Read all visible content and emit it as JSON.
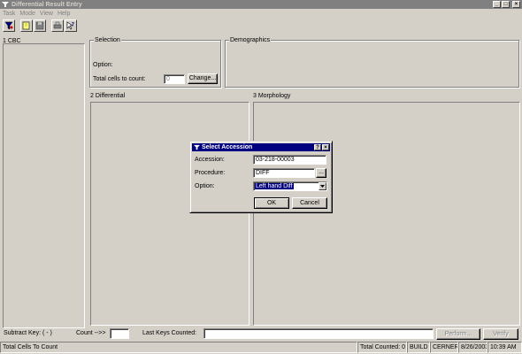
{
  "window": {
    "title": "Differential Result Entry",
    "controls": {
      "minimize": "_",
      "maximize": "□",
      "close": "×"
    }
  },
  "menu": {
    "items": [
      {
        "label": "Task"
      },
      {
        "label": "Mode"
      },
      {
        "label": "View"
      },
      {
        "label": "Help"
      }
    ]
  },
  "toolbar": {
    "buttons": [
      {
        "icon": "filter-funnel-icon"
      },
      {
        "icon": "open-document-icon"
      },
      {
        "icon": "save-disk-icon"
      },
      {
        "icon": "print-icon"
      },
      {
        "icon": "help-cursor-icon"
      }
    ]
  },
  "panels": {
    "cbc": {
      "label": "1  CBC"
    },
    "selection": {
      "label": "Selection",
      "option_label": "Option:",
      "total_cells_label": "Total cells to count:",
      "total_cells_value": "0",
      "change_button": "Change..."
    },
    "demographics": {
      "label": "Demographics"
    },
    "differential": {
      "label": "2  Differential"
    },
    "morphology": {
      "label": "3  Morphology"
    }
  },
  "dialog": {
    "title": "Select Accession",
    "help_button": "?",
    "close_button": "×",
    "accession_label": "Accession:",
    "accession_value": "03-218-00003",
    "procedure_label": "Procedure:",
    "procedure_value": "DIFF",
    "browse_button": "...",
    "option_label": "Option:",
    "option_value": "Left hand Diff",
    "ok_button": "OK",
    "cancel_button": "Cancel"
  },
  "count_row": {
    "subtract_key_label": "Subtract Key:  ( - )",
    "count_label": "Count  -->>",
    "count_value": "",
    "last_keys_label": "Last Keys Counted:",
    "last_keys_value": "",
    "perform_button": "Perform...",
    "verify_button": "Verify"
  },
  "status_bar": {
    "message": "Total Cells To Count",
    "total_counted": "Total Counted:  0",
    "mode": "BUILD",
    "system": "CERNER",
    "date": "8/26/2003",
    "time": "10:39 AM"
  },
  "colors": {
    "face": "#d4d0c8",
    "dialog_title": "#000080",
    "inactive_title": "#808080",
    "selection_highlight": "#000080"
  }
}
